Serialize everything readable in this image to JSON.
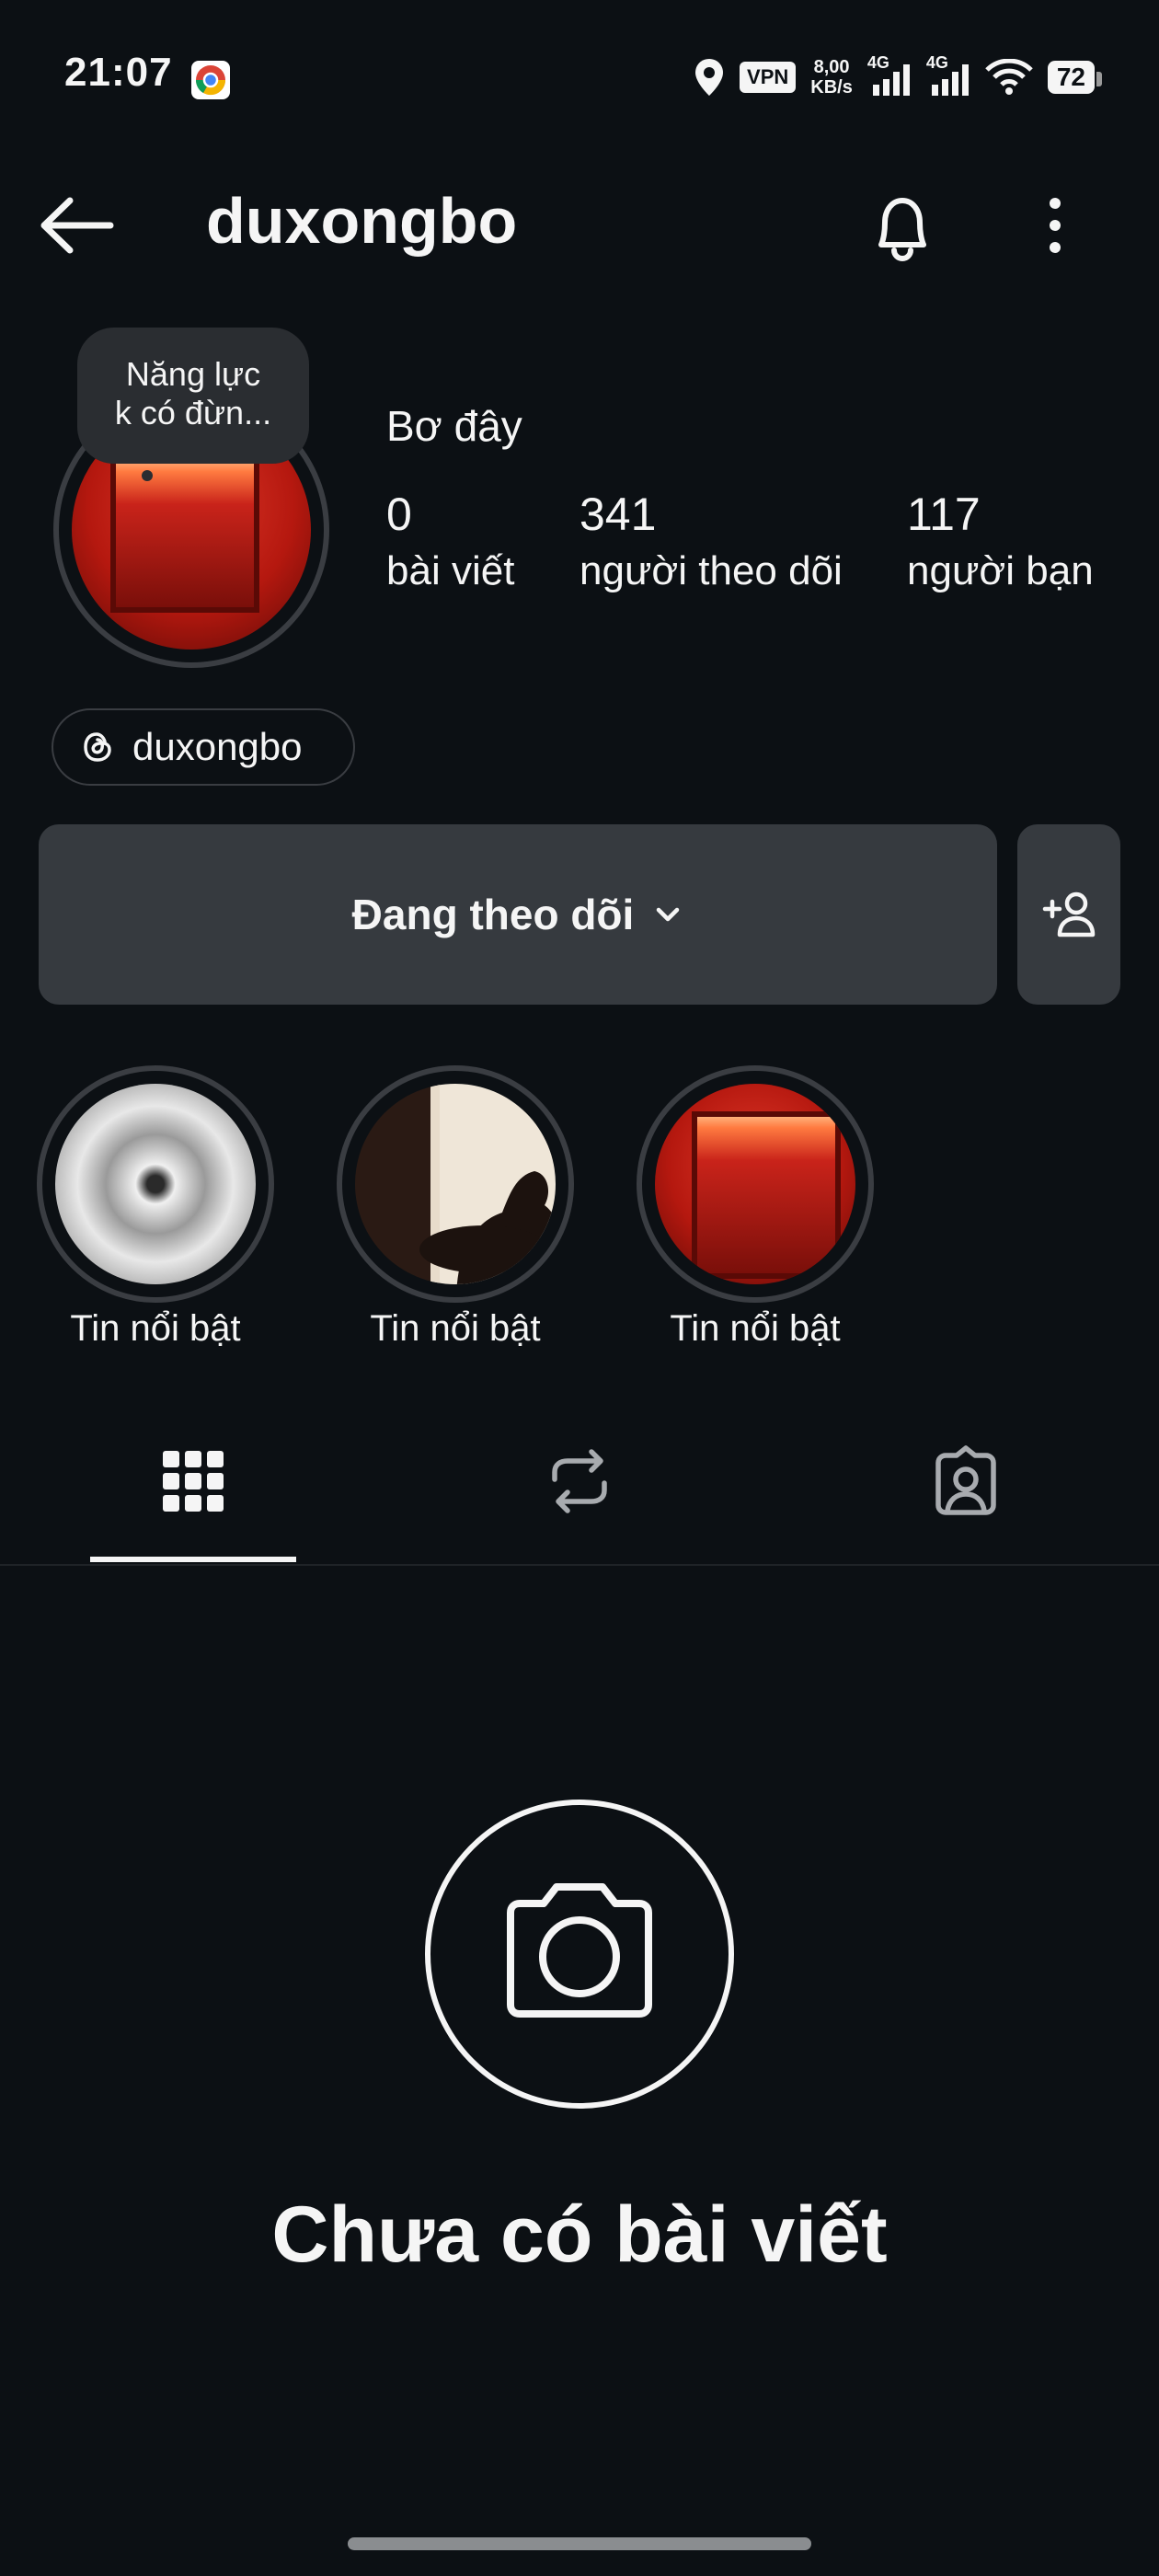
{
  "status_bar": {
    "time": "21:07",
    "vpn": "VPN",
    "speed_value": "8,00",
    "speed_unit": "KB/s",
    "net1": "4G",
    "net2": "4G",
    "battery": "72"
  },
  "header": {
    "username": "duxongbo",
    "back_icon": "arrow-left-icon",
    "bell_icon": "bell-icon",
    "more_icon": "more-vertical-icon"
  },
  "profile": {
    "note_line1": "Năng lực",
    "note_line2": "k có đừn...",
    "bio": "Bơ đây",
    "stats": [
      {
        "value": "0",
        "label": "bài viết"
      },
      {
        "value": "341",
        "label": "người theo dõi"
      },
      {
        "value": "117",
        "label": "người bạn"
      }
    ],
    "threads_handle": "duxongbo"
  },
  "actions": {
    "follow_label": "Đang theo dõi",
    "add_friend_icon": "add-person-icon"
  },
  "highlights": [
    {
      "label": "Tin nổi bật"
    },
    {
      "label": "Tin nổi bật"
    },
    {
      "label": "Tin nổi bật"
    }
  ],
  "tabs": [
    "grid-icon",
    "repost-icon",
    "tagged-icon"
  ],
  "empty_state": {
    "icon": "camera-icon",
    "title": "Chưa có bài viết"
  },
  "colors": {
    "background": "#0c1014",
    "button": "#363a3f",
    "text": "#f5f5f5"
  }
}
